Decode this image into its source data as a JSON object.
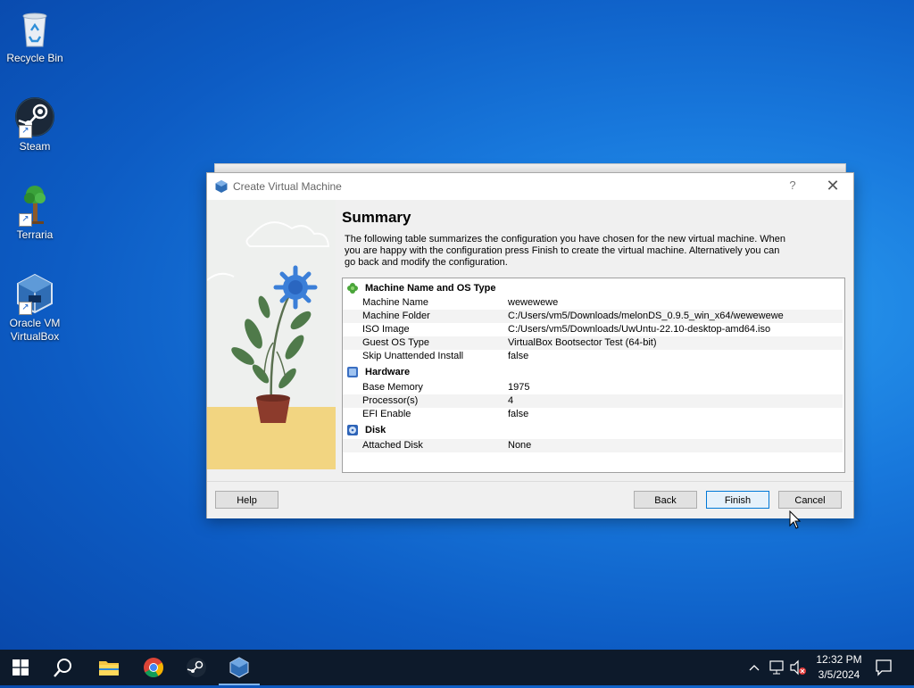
{
  "desktop": {
    "icons": [
      {
        "label": "Recycle Bin"
      },
      {
        "label": "Steam"
      },
      {
        "label": "Terraria"
      },
      {
        "label": "Oracle VM VirtualBox"
      }
    ]
  },
  "dialog": {
    "title": "Create Virtual Machine",
    "help_glyph": "?",
    "close_glyph": "✕",
    "heading": "Summary",
    "description": "The following table summarizes the configuration you have chosen for the new virtual machine. When you are happy with the configuration press Finish to create the virtual machine. Alternatively you can go back and modify the configuration.",
    "sections": {
      "machine": {
        "title": "Machine Name and OS Type",
        "rows": [
          {
            "key": "Machine Name",
            "value": "wewewewe"
          },
          {
            "key": "Machine Folder",
            "value": "C:/Users/vm5/Downloads/melonDS_0.9.5_win_x64/wewewewe"
          },
          {
            "key": "ISO Image",
            "value": "C:/Users/vm5/Downloads/UwUntu-22.10-desktop-amd64.iso"
          },
          {
            "key": "Guest OS Type",
            "value": "VirtualBox Bootsector Test (64-bit)"
          },
          {
            "key": "Skip Unattended Install",
            "value": "false"
          }
        ]
      },
      "hardware": {
        "title": "Hardware",
        "rows": [
          {
            "key": "Base Memory",
            "value": "1975"
          },
          {
            "key": "Processor(s)",
            "value": "4"
          },
          {
            "key": "EFI Enable",
            "value": "false"
          }
        ]
      },
      "disk": {
        "title": "Disk",
        "rows": [
          {
            "key": "Attached Disk",
            "value": "None"
          }
        ]
      }
    },
    "buttons": {
      "help": "Help",
      "back": "Back",
      "finish": "Finish",
      "cancel": "Cancel"
    }
  },
  "taskbar": {
    "clock_time": "12:32 PM",
    "clock_date": "3/5/2024"
  }
}
